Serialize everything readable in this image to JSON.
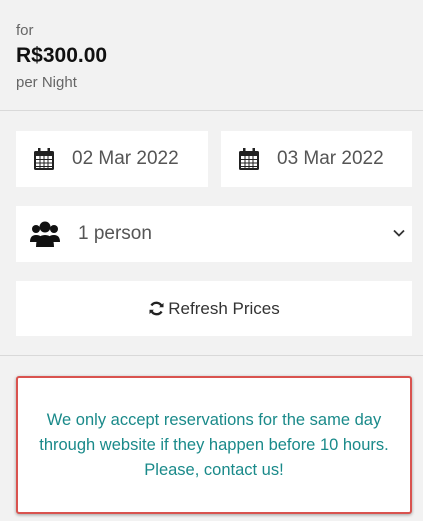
{
  "price": {
    "prefix": "for",
    "amount": "R$300.00",
    "unit": "per Night"
  },
  "dates": {
    "checkin": "02 Mar 2022",
    "checkout": "03 Mar 2022",
    "icon": "calendar-icon"
  },
  "guests": {
    "selected": "1 person",
    "icon": "users-icon",
    "dropdown_icon": "chevron-down-icon"
  },
  "refresh": {
    "label": "Refresh Prices",
    "icon": "refresh-icon"
  },
  "notice": {
    "message": "We only accept reservations for the same day through website if they happen before 10 hours.",
    "cta": "Please, contact us!"
  },
  "colors": {
    "notice_text": "#1a8a8a",
    "notice_border": "#d9534f",
    "background": "#f2f2f2"
  }
}
